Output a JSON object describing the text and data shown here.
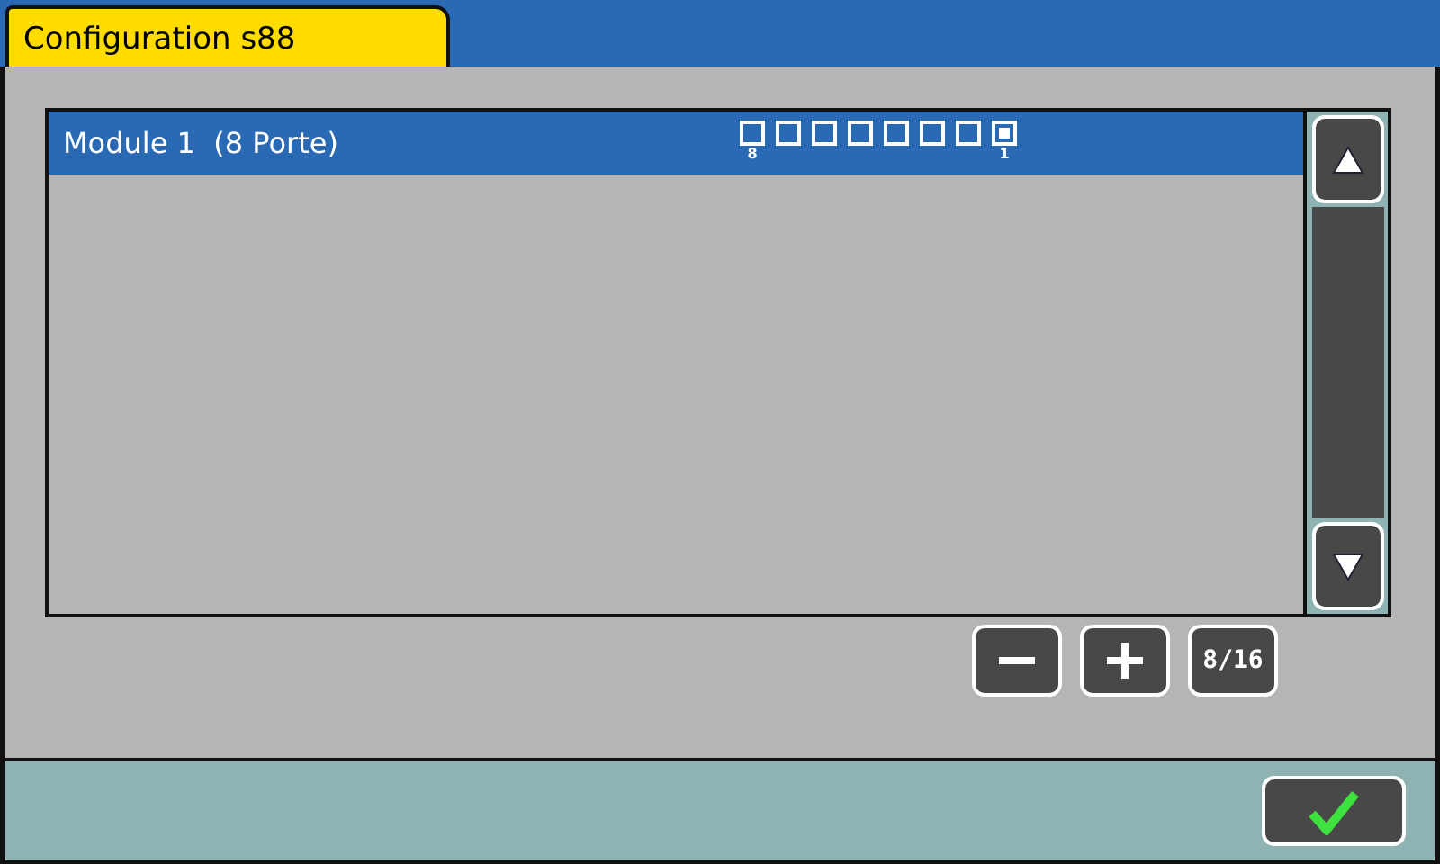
{
  "tab": {
    "title": "Configuration s88",
    "selected": true
  },
  "modules": [
    {
      "label": "Module 1  (8 Porte)",
      "selected": true,
      "ports": [
        {
          "label": "8",
          "active": false
        },
        {
          "active": false
        },
        {
          "active": false
        },
        {
          "active": false
        },
        {
          "active": false
        },
        {
          "active": false
        },
        {
          "active": false
        },
        {
          "label": "1",
          "active": true
        }
      ]
    }
  ],
  "counter": "8/16"
}
